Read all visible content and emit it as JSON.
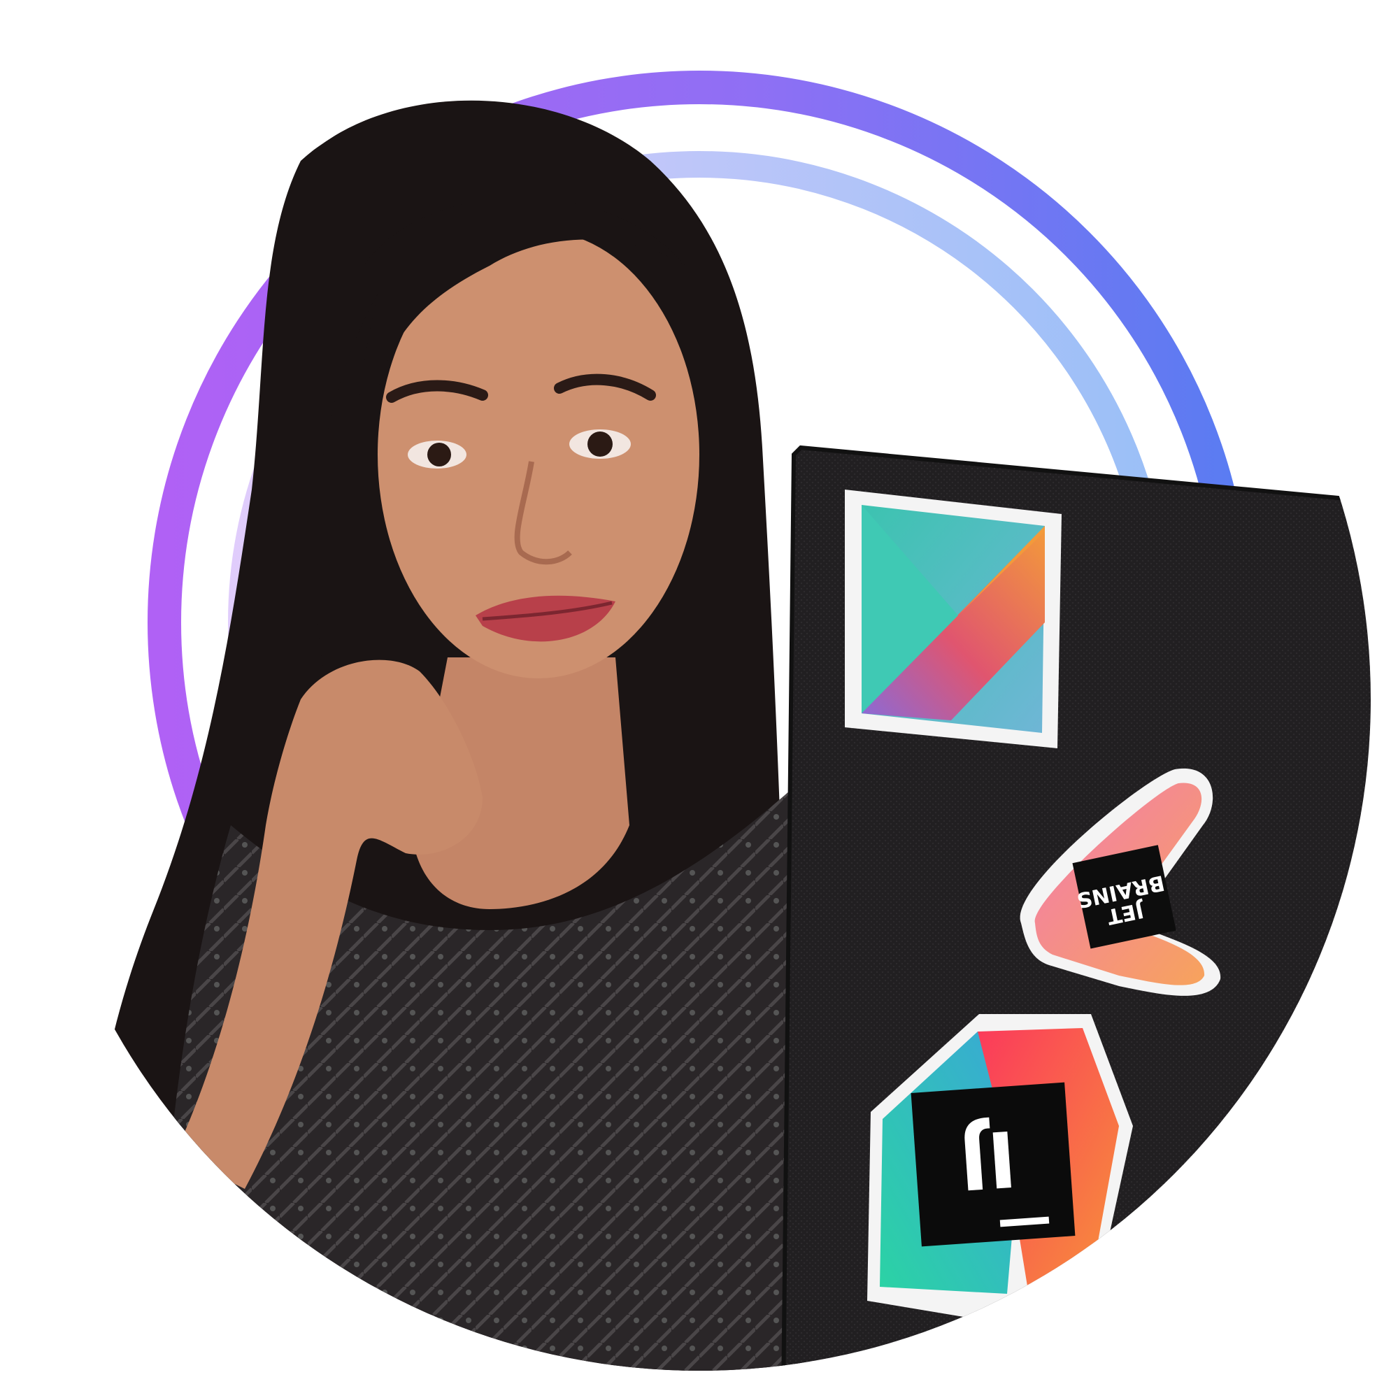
{
  "colors": {
    "background": "#ffffff",
    "ring_outer_start": "#b061f5",
    "ring_outer_end": "#5a7cf2",
    "ring_inner_start": "#d8c8fb",
    "ring_inner_end": "#8fb6f6",
    "hair": "#1a1414",
    "skin": "#c98c6c",
    "shirt": "#2a2628",
    "laptop": "#1f1d1f"
  },
  "stickers": {
    "kotlin": {
      "icon": "kotlin-logo-sticker"
    },
    "jetbrains": {
      "icon": "jetbrains-logo-sticker",
      "line1": "JET",
      "line2": "BRAINS"
    },
    "intellij": {
      "icon": "intellij-idea-logo-sticker",
      "text": "IJ"
    }
  }
}
